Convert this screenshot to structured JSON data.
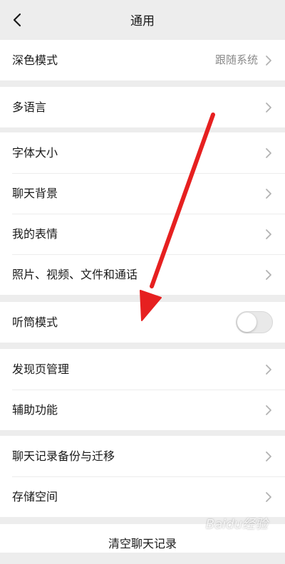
{
  "nav": {
    "title": "通用"
  },
  "groups": [
    {
      "items": [
        {
          "label": "深色模式",
          "value": "跟随系统"
        }
      ]
    },
    {
      "items": [
        {
          "label": "多语言"
        }
      ]
    },
    {
      "items": [
        {
          "label": "字体大小"
        },
        {
          "label": "聊天背景"
        },
        {
          "label": "我的表情"
        },
        {
          "label": "照片、视频、文件和通话"
        }
      ]
    },
    {
      "items": [
        {
          "label": "听筒模式",
          "toggle": false
        }
      ]
    },
    {
      "items": [
        {
          "label": "发现页管理"
        },
        {
          "label": "辅助功能"
        }
      ]
    },
    {
      "items": [
        {
          "label": "聊天记录备份与迁移"
        },
        {
          "label": "存储空间"
        }
      ]
    }
  ],
  "footer": {
    "clear_label": "清空聊天记录"
  },
  "watermark": {
    "text": "Baidu经验"
  },
  "colors": {
    "annotation_arrow": "#e62020",
    "background": "#ededed"
  }
}
